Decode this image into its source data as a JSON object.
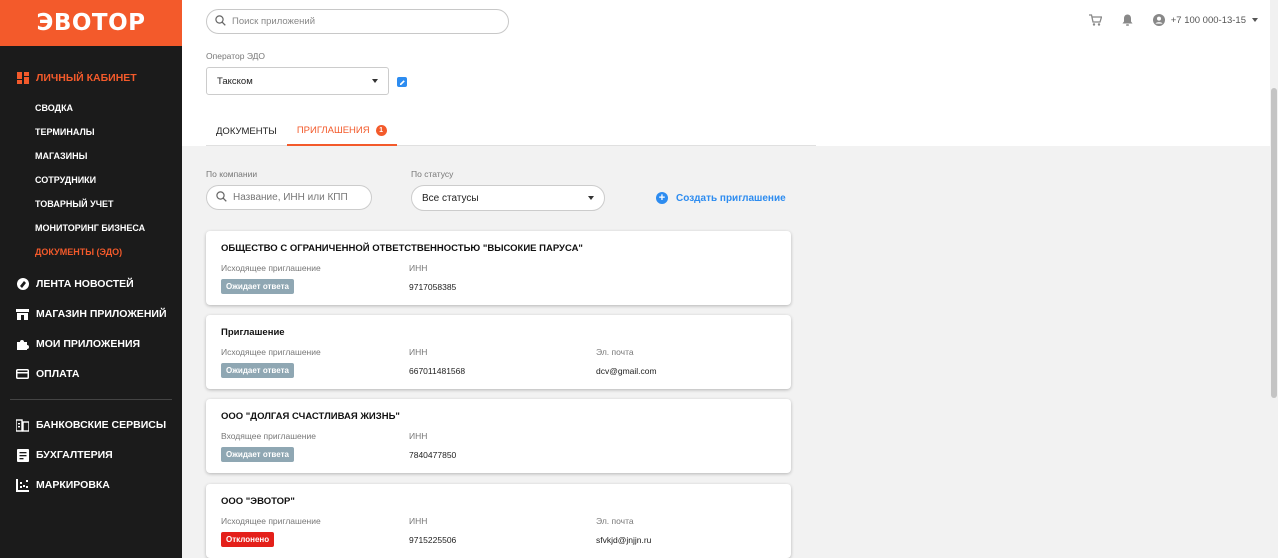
{
  "brand": {
    "logo": "ЭВОТОР",
    "accent": "#f35a2b",
    "link": "#2d8cf0"
  },
  "sidebar": {
    "account": "ЛИЧНЫЙ КАБИНЕТ",
    "subitems": [
      "СВОДКА",
      "ТЕРМИНАЛЫ",
      "МАГАЗИНЫ",
      "СОТРУДНИКИ",
      "ТОВАРНЫЙ УЧЕТ",
      "МОНИТОРИНГ БИЗНЕСА",
      "ДОКУМЕНТЫ (ЭДО)"
    ],
    "items": [
      "ЛЕНТА НОВОСТЕЙ",
      "МАГАЗИН ПРИЛОЖЕНИЙ",
      "МОИ ПРИЛОЖЕНИЯ",
      "ОПЛАТА"
    ],
    "items2": [
      "БАНКОВСКИЕ СЕРВИСЫ",
      "БУХГАЛТЕРИЯ",
      "МАРКИРОВКА"
    ]
  },
  "topbar": {
    "search_placeholder": "Поиск приложений",
    "phone": "+7 100 000-13-15"
  },
  "operator": {
    "label": "Оператор ЭДО",
    "value": "Такском"
  },
  "tabs": [
    {
      "label": "ДОКУМЕНТЫ"
    },
    {
      "label": "ПРИГЛАШЕНИЯ",
      "badge": "1"
    }
  ],
  "filters": {
    "company_label": "По компании",
    "company_placeholder": "Название, ИНН или КПП",
    "status_label": "По статусу",
    "status_value": "Все статусы",
    "create": "Создать приглашение"
  },
  "invitations": [
    {
      "title": "ОБЩЕСТВО С ОГРАНИЧЕННОЙ ОТВЕТСТВЕННОСТЬЮ \"ВЫСОКИЕ ПАРУСА\"",
      "type": "Исходящее приглашение",
      "status": "Ожидает ответа",
      "inn_label": "ИНН",
      "inn": "9717058385",
      "email_label": "",
      "email": ""
    },
    {
      "title": "Приглашение",
      "type": "Исходящее приглашение",
      "status": "Ожидает ответа",
      "inn_label": "ИНН",
      "inn": "667011481568",
      "email_label": "Эл. почта",
      "email": "dcv@gmail.com"
    },
    {
      "title": "ООО \"ДОЛГАЯ СЧАСТЛИВАЯ ЖИЗНЬ\"",
      "type": "Входящее приглашение",
      "status": "Ожидает ответа",
      "inn_label": "ИНН",
      "inn": "7840477850",
      "email_label": "",
      "email": ""
    },
    {
      "title": "ООО \"ЭВОТОР\"",
      "type": "Исходящее приглашение",
      "status": "Отклонено",
      "inn_label": "ИНН",
      "inn": "9715225506",
      "email_label": "Эл. почта",
      "email": "sfvkjd@jnjjn.ru"
    }
  ]
}
